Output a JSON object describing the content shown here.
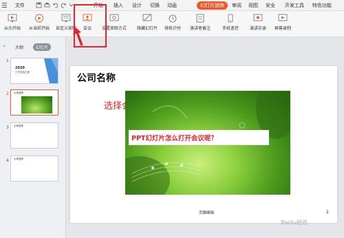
{
  "menubar": {
    "file": "文件",
    "tabs": [
      {
        "label": "开始",
        "active": false
      },
      {
        "label": "插入",
        "active": false
      },
      {
        "label": "设计",
        "active": false
      },
      {
        "label": "切换",
        "active": false
      },
      {
        "label": "动画",
        "active": false
      },
      {
        "label": "幻灯片放映",
        "active": true
      },
      {
        "label": "审阅",
        "active": false
      },
      {
        "label": "视图",
        "active": false
      },
      {
        "label": "安全",
        "active": false
      },
      {
        "label": "开发工具",
        "active": false
      },
      {
        "label": "特色功能",
        "active": false
      }
    ]
  },
  "ribbon": {
    "buttons": [
      {
        "label": "从头开始",
        "icon": "play-from-start-icon"
      },
      {
        "label": "从当前开始",
        "icon": "play-from-current-icon"
      },
      {
        "label": "自定义放映",
        "icon": "custom-show-icon"
      },
      {
        "label": "会议",
        "icon": "meeting-icon"
      },
      {
        "label": "设置放映方式",
        "icon": "setup-show-icon"
      },
      {
        "label": "隐藏幻灯片",
        "icon": "hide-slide-icon"
      },
      {
        "label": "排练计时",
        "icon": "rehearse-timing-icon"
      },
      {
        "label": "演讲者备注",
        "icon": "speaker-notes-icon"
      },
      {
        "label": "手机遥控",
        "icon": "phone-remote-icon"
      },
      {
        "label": "演讲实录",
        "icon": "record-speech-icon"
      },
      {
        "label": "屏幕录制",
        "icon": "screen-record-icon"
      }
    ]
  },
  "panel": {
    "tabs": [
      {
        "label": "大纲",
        "active": false
      },
      {
        "label": "幻灯片",
        "active": true
      }
    ],
    "slides": [
      {
        "num": "1",
        "selected": false,
        "line1": "2020",
        "line2": "工作总结汇报"
      },
      {
        "num": "2",
        "selected": true,
        "line1": "公司名称"
      },
      {
        "num": "3",
        "selected": false,
        "line1": "公司名称"
      },
      {
        "num": "4",
        "selected": false,
        "line1": "公司名称"
      }
    ]
  },
  "slide": {
    "company": "公司名称",
    "annotation": "选择会议",
    "title": "PPT幻灯片怎么打开会议呢？",
    "footer": "页脚编辑",
    "page_number": "2"
  },
  "watermark": "Baidu经验",
  "colors": {
    "accent": "#e85a2a",
    "highlight": "#e8222a"
  }
}
